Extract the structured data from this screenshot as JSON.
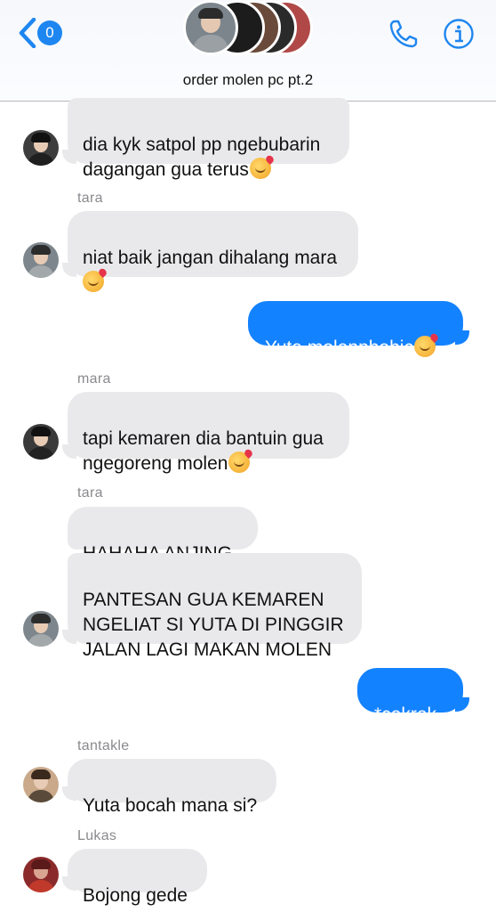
{
  "header": {
    "back_count": "0",
    "group_name": "order molen pc pt.2",
    "accent_color": "#1e86f0",
    "icons": [
      "chevron-left-icon",
      "phone-icon",
      "info-icon"
    ]
  },
  "messages": {
    "m1": {
      "text": "dia kyk satpol pp ngebubarin\ndagangan gua terus"
    },
    "m2": {
      "sender": "tara",
      "text": "niat baik jangan dihalang mara\n"
    },
    "m3": {
      "text": "Yuta molenphobic"
    },
    "m4": {
      "sender": "mara",
      "text": "tapi kemaren dia bantuin gua\nngegoreng molen"
    },
    "m5": {
      "sender": "tara",
      "text": "HAHAHA ANJING"
    },
    "m6": {
      "text": "PANTESAN GUA KEMAREN\nNGELIAT SI YUTA DI PINGGIR\nJALAN LAGI MAKAN MOLEN"
    },
    "m7": {
      "text": "*cekrek"
    },
    "m8": {
      "sender": "tantakle",
      "text": "Yuta bocah mana si?"
    },
    "m9": {
      "sender": "Lukas",
      "text": "Bojong gede"
    }
  },
  "colors": {
    "incoming_bubble": "#e9e9eb",
    "outgoing_bubble": "#1382ff",
    "sender_name": "#8a8a8e"
  }
}
